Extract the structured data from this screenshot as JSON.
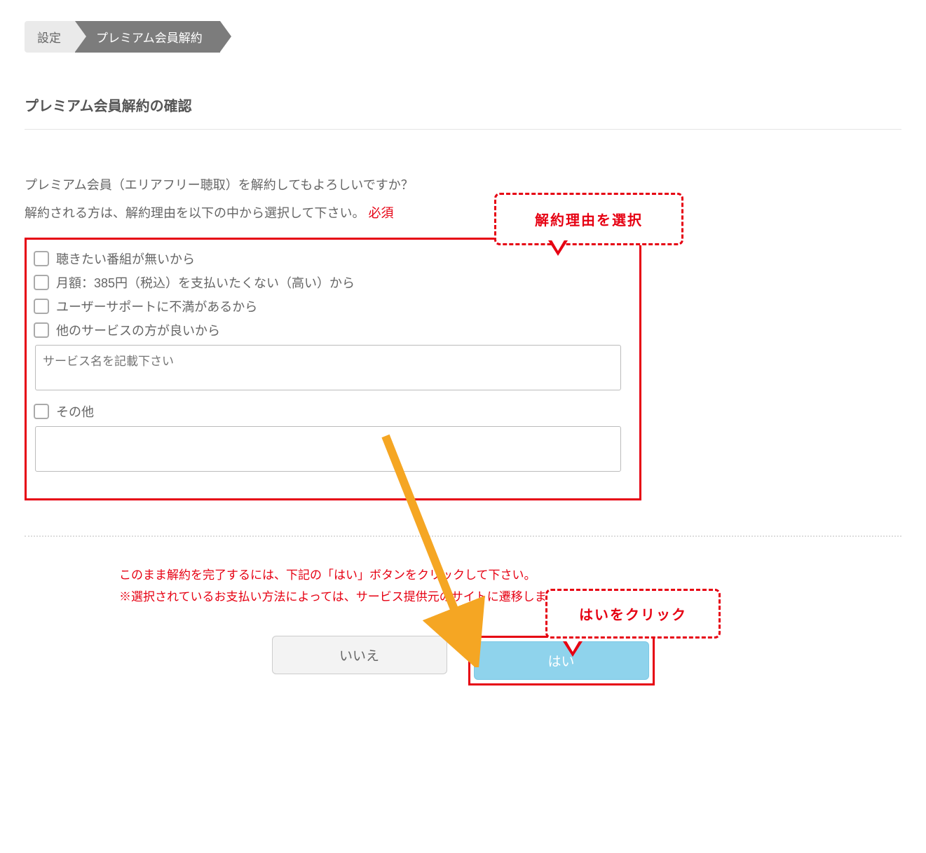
{
  "breadcrumb": {
    "item1": "設定",
    "item2": "プレミアム会員解約"
  },
  "title": "プレミアム会員解約の確認",
  "description_line1": "プレミアム会員（エリアフリー聴取）を解約してもよろしいですか？",
  "description_line2_prefix": "解約される方は、解約理由を以下の中から選択して下さい。",
  "required_label": "必須",
  "reasons": {
    "item0": "聴きたい番組が無いから",
    "item1": "月額：385円（税込）を支払いたくない（高い）から",
    "item2": "ユーザーサポートに不満があるから",
    "item3": "他のサービスの方が良いから",
    "item4": "その他",
    "service_placeholder": "サービス名を記載下さい"
  },
  "notice_line1": "このまま解約を完了するには、下記の「はい」ボタンをクリックして下さい。",
  "notice_line2": "※選択されているお支払い方法によっては、サービス提供元のサイトに遷移します。",
  "buttons": {
    "no": "いいえ",
    "yes": "はい"
  },
  "annotations": {
    "callout1": "解約理由を選択",
    "callout2": "はいをクリック"
  }
}
